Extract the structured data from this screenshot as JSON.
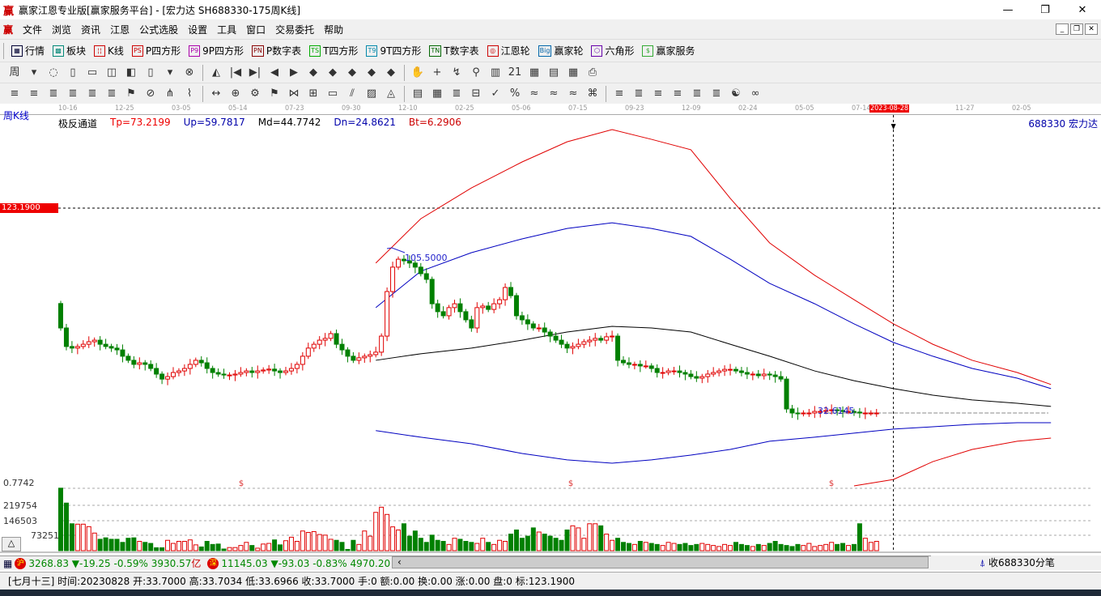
{
  "window": {
    "title": "赢家江恩专业版[赢家服务平台] - [宏力达  SH688330-175周K线]",
    "logo": "赢",
    "controls": [
      "—",
      "❐",
      "✕"
    ]
  },
  "menu": {
    "logo": "赢",
    "items": [
      "文件",
      "浏览",
      "资讯",
      "江恩",
      "公式选股",
      "设置",
      "工具",
      "窗口",
      "交易委托",
      "帮助"
    ],
    "mdi": [
      "_",
      "❐",
      "✕"
    ]
  },
  "toolbar1": [
    {
      "icon": "▦",
      "label": "行情",
      "color": "#003"
    },
    {
      "icon": "▩",
      "label": "板块",
      "color": "#087"
    },
    {
      "icon": "¦¦",
      "label": "K线",
      "color": "#c00"
    },
    {
      "icon": "PS",
      "label": "P四方形",
      "color": "#c00"
    },
    {
      "icon": "P9",
      "label": "9P四方形",
      "color": "#a0a"
    },
    {
      "icon": "PN",
      "label": "P数字表",
      "color": "#800"
    },
    {
      "icon": "TS",
      "label": "T四方形",
      "color": "#0a0"
    },
    {
      "icon": "T9",
      "label": "9T四方形",
      "color": "#08a"
    },
    {
      "icon": "TN",
      "label": "T数字表",
      "color": "#060"
    },
    {
      "icon": "◎",
      "label": "江恩轮",
      "color": "#c00"
    },
    {
      "icon": "Big",
      "label": "赢家轮",
      "color": "#06a"
    },
    {
      "icon": "⬡",
      "label": "六角形",
      "color": "#60a"
    },
    {
      "icon": "$",
      "label": "赢家服务",
      "color": "#3a3"
    }
  ],
  "toolbar2": [
    "周",
    "▾",
    "◌",
    "▯",
    "▭",
    "◫",
    "◧",
    "▯",
    "▾",
    "⊗",
    "◭",
    "|◀",
    "▶|",
    "◀",
    "▶",
    "◆",
    "◆",
    "◆",
    "◆",
    "◆",
    "✋",
    "+",
    "↯",
    "⚲",
    "▥",
    "21",
    "▦",
    "▤",
    "▦",
    "⎙"
  ],
  "toolbar3": [
    "≡",
    "≡",
    "≣",
    "≣",
    "≣",
    "≣",
    "⚑",
    "⊘",
    "⋔",
    "⌇",
    "↔",
    "⊕",
    "⚙",
    "⚑",
    "⋈",
    "⊞",
    "▭",
    "⫽",
    "▨",
    "◬",
    "▤",
    "▦",
    "≣",
    "⊟",
    "✓",
    "%",
    "≈",
    "≈",
    "≈",
    "⌘",
    "≡",
    "≣",
    "≡",
    "≡",
    "≣",
    "≣",
    "☯",
    "∞"
  ],
  "chart": {
    "period": "周K线",
    "stock": "688330 宏力达",
    "indicator": {
      "name": "极反通道",
      "tp": "Tp=73.2199",
      "up": "Up=59.7817",
      "md": "Md=44.7742",
      "dn": "Dn=24.8621",
      "bt": "Bt=6.2906"
    },
    "cursor_price": "123.1900",
    "cursor_price_value": 123.19,
    "cursor_index": 148,
    "high_label": "105.5000",
    "low_label": "32.6145",
    "low_value": 32.6145,
    "dates": [
      "10-16",
      "12-25",
      "03-05",
      "05-14",
      "07-23",
      "09-30",
      "12-10",
      "02-25",
      "05-06",
      "07-15",
      "09-23",
      "12-09",
      "02-24",
      "05-05",
      "07-14",
      "2023-08-28",
      "11-27",
      "02-05"
    ],
    "selected_date": "2023-08-28",
    "volume_labels": [
      "0.7742",
      "219754",
      "146503",
      "73251"
    ],
    "volume_ticks": [
      219754,
      146503,
      73251
    ],
    "dollar_marks": [
      "$",
      "$",
      "$"
    ],
    "collapse": "△"
  },
  "chart_data": {
    "type": "candlestick",
    "first_open": 81,
    "closes": [
      70.2,
      62.0,
      61.3,
      62.0,
      63.0,
      64.1,
      64.8,
      63.0,
      62.0,
      61.3,
      60.5,
      57.7,
      55.9,
      54.1,
      54.8,
      54.1,
      52.3,
      49.8,
      47.6,
      48.7,
      50.5,
      51.2,
      52.3,
      54.1,
      55.9,
      54.8,
      52.3,
      50.5,
      49.8,
      49.4,
      49.4,
      49.8,
      50.5,
      51.2,
      50.5,
      51.2,
      51.6,
      52.0,
      51.2,
      50.5,
      51.2,
      52.3,
      54.1,
      57.7,
      61.3,
      63.0,
      64.8,
      65.6,
      67.7,
      63.0,
      60.5,
      57.7,
      55.9,
      57.0,
      57.7,
      58.4,
      59.5,
      66.6,
      86.3,
      97.1,
      100.6,
      99.9,
      98.9,
      97.1,
      94.2,
      91.7,
      80.9,
      77.4,
      75.6,
      79.2,
      80.9,
      77.4,
      73.8,
      70.2,
      79.2,
      79.9,
      78.4,
      80.9,
      82.7,
      88.1,
      84.5,
      75.6,
      73.8,
      72.0,
      70.2,
      70.2,
      68.4,
      66.6,
      64.8,
      63.0,
      61.3,
      62.0,
      63.0,
      64.1,
      64.8,
      65.6,
      64.8,
      66.3,
      66.6,
      55.9,
      54.8,
      54.1,
      54.1,
      53.4,
      53.4,
      52.3,
      50.5,
      50.5,
      51.2,
      51.2,
      50.5,
      49.8,
      48.7,
      48.0,
      48.7,
      49.8,
      50.5,
      51.2,
      51.9,
      51.9,
      51.2,
      50.5,
      49.8,
      49.8,
      49.1,
      49.8,
      49.4,
      48.7,
      47.6,
      34.4,
      32.6,
      32.3,
      32.6,
      32.6,
      33.3,
      33.3,
      33.7,
      34.0,
      33.7,
      33.3,
      33.3,
      33.0,
      32.6,
      32.6,
      32.6,
      32.6
    ],
    "volumes": [
      302,
      230,
      130,
      128,
      128,
      116,
      85,
      55,
      62,
      55,
      55,
      40,
      60,
      62,
      45,
      40,
      35,
      14,
      14,
      50,
      35,
      45,
      45,
      52,
      28,
      18,
      45,
      30,
      32,
      8,
      15,
      15,
      25,
      40,
      25,
      12,
      32,
      35,
      52,
      28,
      48,
      65,
      45,
      95,
      88,
      92,
      78,
      75,
      55,
      50,
      40,
      6,
      50,
      30,
      95,
      70,
      185,
      210,
      175,
      115,
      100,
      130,
      70,
      95,
      60,
      40,
      75,
      50,
      45,
      30,
      60,
      55,
      45,
      40,
      35,
      60,
      40,
      30,
      50,
      45,
      80,
      100,
      60,
      70,
      110,
      90,
      80,
      70,
      60,
      50,
      100,
      120,
      110,
      60,
      130,
      130,
      120,
      80,
      50,
      60,
      40,
      35,
      30,
      45,
      40,
      35,
      30,
      25,
      40,
      35,
      30,
      35,
      25,
      30,
      35,
      30,
      25,
      20,
      30,
      25,
      40,
      30,
      25,
      20,
      30,
      25,
      35,
      45,
      30,
      25,
      20,
      30,
      25,
      35,
      20,
      25,
      30,
      40,
      30,
      35,
      25,
      30,
      130,
      60,
      40,
      45,
      60,
      50,
      55,
      40,
      40,
      45
    ],
    "volume_unit": "thousand",
    "channel_index": [
      56,
      64,
      73,
      82,
      90,
      98,
      105,
      112,
      119,
      126,
      134,
      141,
      148,
      155,
      162,
      170,
      176
    ],
    "series": [
      {
        "name": "Tp",
        "color": "#e00000",
        "values": [
          98.9,
          118.5,
          132.1,
          143.6,
          152.5,
          157.9,
          153.6,
          149.0,
          127.5,
          107.8,
          93.5,
          82.7,
          72.0,
          63.0,
          55.9,
          50.5,
          45.2
        ]
      },
      {
        "name": "Up",
        "color": "#0000c0",
        "values": [
          79.2,
          95.3,
          103.5,
          109.6,
          114.2,
          116.7,
          114.2,
          110.7,
          100.6,
          89.9,
          80.9,
          72.0,
          63.8,
          57.7,
          52.3,
          48.0,
          43.4
        ]
      },
      {
        "name": "Md",
        "color": "#000000",
        "values": [
          55.9,
          58.8,
          61.3,
          64.8,
          68.4,
          70.9,
          70.2,
          68.4,
          63.0,
          57.7,
          51.2,
          46.9,
          43.4,
          40.5,
          38.4,
          36.9,
          35.5
        ]
      },
      {
        "name": "Dn",
        "color": "#0000c0",
        "values": [
          24.8,
          21.9,
          19.0,
          14.7,
          11.9,
          10.4,
          11.9,
          14.0,
          16.5,
          20.1,
          21.9,
          23.7,
          25.5,
          26.5,
          27.6,
          28.3,
          28.3
        ]
      },
      {
        "name": "Bt",
        "color": "#e00000",
        "values": [
          null,
          null,
          null,
          null,
          null,
          null,
          null,
          null,
          null,
          null,
          null,
          -1.8,
          3.2,
          11.1,
          16.5,
          20.1,
          21.5
        ]
      }
    ]
  },
  "index_bar": {
    "sh_badge": "沪",
    "sh": "3268.83 ▼-19.25 -0.59% 3930.57",
    "sh_unit": "亿",
    "sz_badge": "深",
    "sz": "11145.03 ▼-93.03 -0.83% 4970.20",
    "scroll_left": "‹",
    "scroll_right": "›",
    "tick_label": "收688330分笔"
  },
  "status": "[七月十三] 时间:20230828 开:33.7000 高:33.7034 低:33.6966 收:33.7000 手:0 额:0.00 换:0.00 涨:0.00 盘:0 标:123.1900"
}
